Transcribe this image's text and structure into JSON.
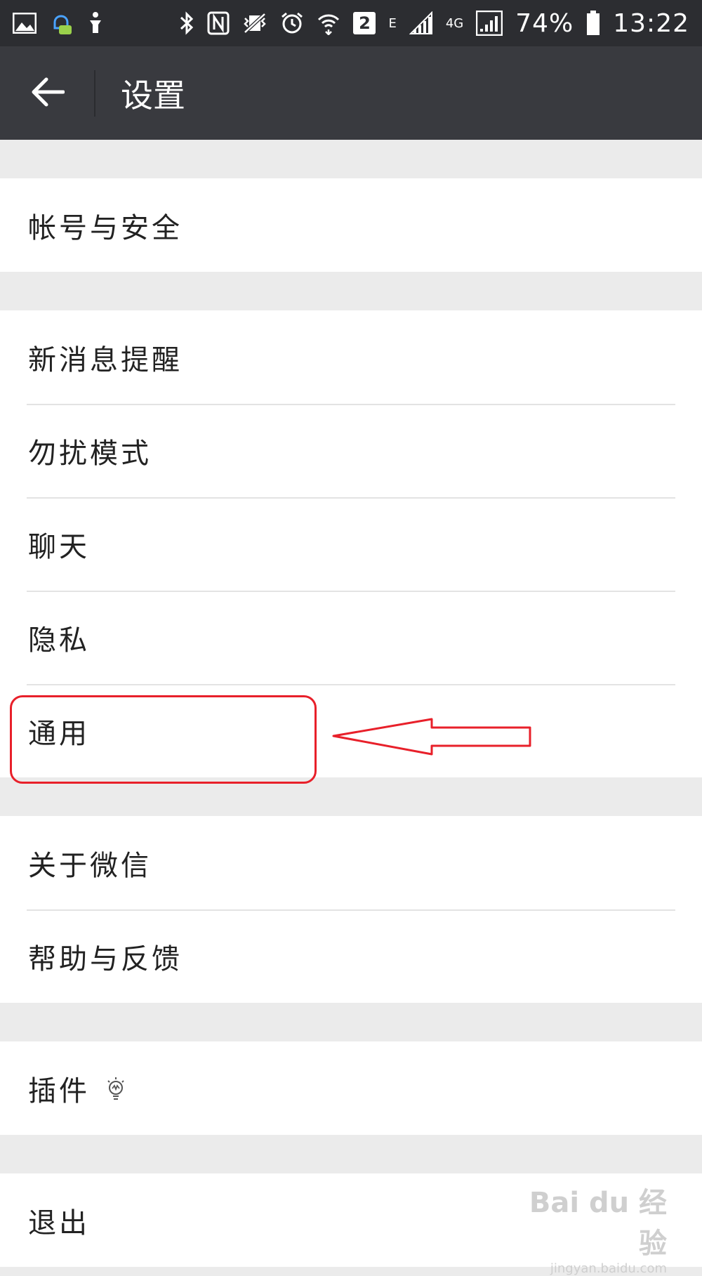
{
  "statusbar": {
    "network_e": "E",
    "network_4g": "4G",
    "sim_badge": "2",
    "battery": "74%",
    "time": "13:22"
  },
  "appbar": {
    "title": "设置"
  },
  "groups": [
    {
      "items": [
        "帐号与安全"
      ]
    },
    {
      "items": [
        "新消息提醒",
        "勿扰模式",
        "聊天",
        "隐私",
        "通用"
      ]
    },
    {
      "items": [
        "关于微信",
        "帮助与反馈"
      ]
    },
    {
      "items": [
        "插件"
      ]
    },
    {
      "items": [
        "退出"
      ]
    }
  ],
  "colors": {
    "statusbar": "#2c2d31",
    "appbar": "#393a3f",
    "annotation": "#e8202a"
  },
  "watermark": {
    "brand": "Bai du 经验",
    "url": "jingyan.baidu.com"
  }
}
